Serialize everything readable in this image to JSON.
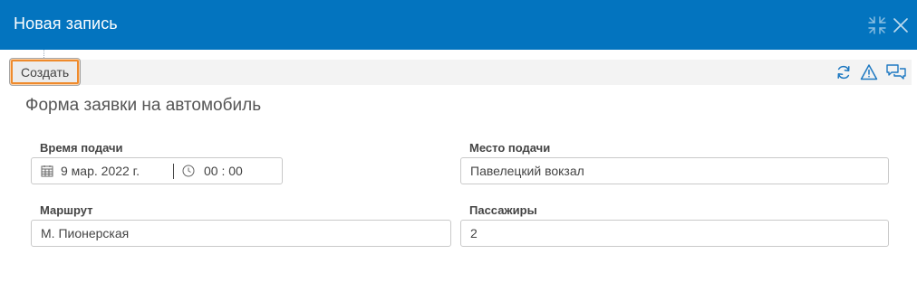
{
  "window": {
    "title": "Новая запись",
    "collapse_icon": "compress-icon",
    "close_icon": "close-icon"
  },
  "toolbar": {
    "create_label": "Создать",
    "icons": [
      "refresh-icon",
      "warning-icon",
      "chat-icon"
    ]
  },
  "form": {
    "title": "Форма заявки на автомобиль",
    "fields": {
      "time": {
        "label": "Время подачи",
        "date": "9 мар. 2022 г.",
        "time": "00 : 00"
      },
      "place": {
        "label": "Место подачи",
        "value": "Павелецкий вокзал"
      },
      "route": {
        "label": "Маршрут",
        "value": "М. Пионерская"
      },
      "passengers": {
        "label": "Пассажиры",
        "value": "2"
      }
    }
  },
  "colors": {
    "header": "#0374bf",
    "accent": "#ef8a2b",
    "icon": "#1d78c1"
  }
}
